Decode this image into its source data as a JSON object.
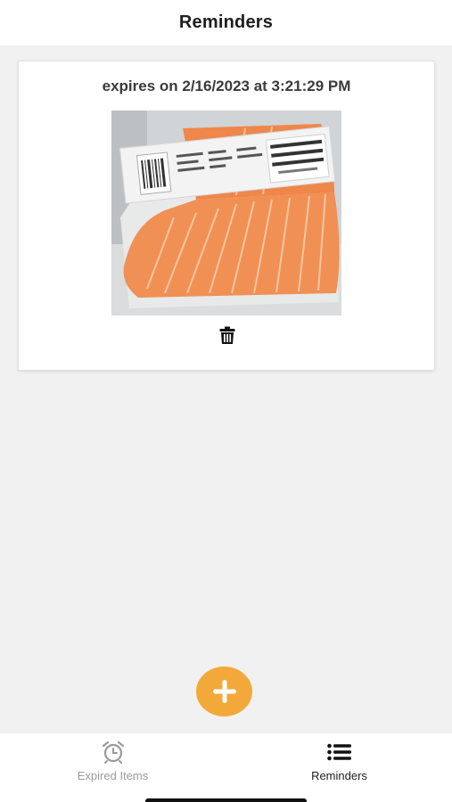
{
  "header": {
    "title": "Reminders"
  },
  "reminders": [
    {
      "expiry_text": "expires on 2/16/2023 at 3:21:29 PM",
      "photo": {
        "subject": "salmon-fillet",
        "label_lines": [
          "FRESH",
          "ATLANTIC",
          "SALMON"
        ]
      },
      "delete_icon": "trash-icon"
    }
  ],
  "fab": {
    "icon": "plus-icon",
    "color": "#f3a93a"
  },
  "tabbar": {
    "tabs": [
      {
        "label": "Expired Items",
        "icon": "alarm-clock-icon",
        "active": false
      },
      {
        "label": "Reminders",
        "icon": "list-icon",
        "active": true
      }
    ]
  },
  "colors": {
    "accent": "#f3a93a",
    "background": "#f1f1f1",
    "inactive_tab": "#9a9a9a"
  }
}
